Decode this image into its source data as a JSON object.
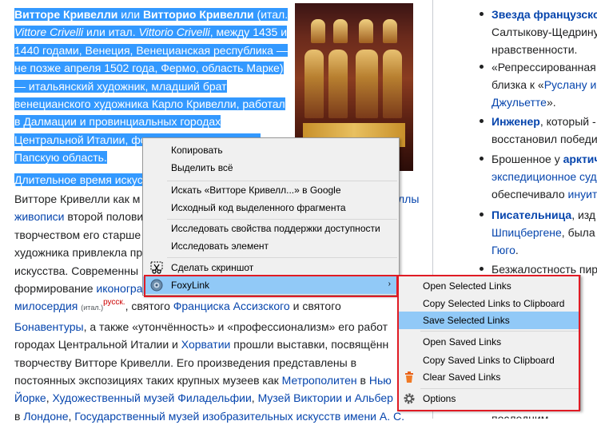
{
  "article": {
    "p1_bold1": "Витторе Кривелли",
    "p1_t1": " или ",
    "p1_bold2": "Витторио Кривелли",
    "p1_t2": " (итал. ",
    "p1_i1": "Vittore Crivelli",
    "p1_t3": " или итал. ",
    "p1_i2": "Vittorio Crivelli",
    "p1_t4": ", между 1435 и 1440 годами, Венеция, Венецианская республика — не позже апреля 1502 года, Фермо, область Марке) — итальянский художник, младший брат венецианского художника Карло Кривелли, работал в Далмации и провинциальных городах Центральной Италии, формально входивших в Папскую область.",
    "p2_text": "Длительное время искус",
    "p3_l1": "Витторе Кривелли как м",
    "p3_l1_link": "ллы",
    "p3_l2_link": "живописи",
    "p3_l2": " второй полови",
    "p3_l3": "творчеством его старше",
    "p3_l4": "художника привлекла пр",
    "p3_l5": "искусства. Современны",
    "p3_l6": "формирование ",
    "p3_l6_link": "иконогра",
    "p3_l7_link": "милосердия",
    "p3_l7_sub": "(итал.)",
    "p3_l7_sup": "русск.",
    "p3_l7_t": ", святого ",
    "p3_l7_link2": "Франциска Ассизского",
    "p3_l7_t2": " и святого",
    "p3_l8_link": "Бонавентуры",
    "p3_l8_t": ", а также «утончённость» и «профессионализм» его работ",
    "p3_l9_t": "городах Центральной Италии и ",
    "p3_l9_link": "Хорватии",
    "p3_l9_t2": " прошли выставки, посвящённ",
    "p3_l10": "творчеству Витторе Кривелли. Его произведения представлены в",
    "p3_l11_t": "постоянных экспозициях таких крупных музеев как ",
    "p3_l11_link": "Метрополитен",
    "p3_l11_t2": " в ",
    "p3_l11_link2": "Нью",
    "p3_l12_link": "Йорке",
    "p3_l12_t": ", ",
    "p3_l12_link2": "Художественный музей Филадельфии",
    "p3_l12_link3": "Музей Виктории и Альбер",
    "p3_l13_t": "в ",
    "p3_l13_link": "Лондоне",
    "p3_l13_link2": "Государственный музей изобразительных искусств имени А. С."
  },
  "sidebar": {
    "r1_link": "Звезда французско",
    "r2": "Салтыкову-Щедрину",
    "r3": "нравственности.",
    "r4": "«Репрессированная",
    "r5_t": "близка к «",
    "r5_link": "Руслану и",
    "r6_link": "Джульетте",
    "r6_t": "».",
    "r7_link": "Инженер",
    "r7_t": ", который -",
    "r8": "восстановил победител",
    "r9_t": "Брошенное у ",
    "r9_link": "арктич",
    "r10_link": "экспедиционное суд",
    "r11_t": "обеспечивало ",
    "r11_link": "инуит",
    "r12_link": "Писательница",
    "r12_t": ", изд",
    "r13_link": "Шпицбергене",
    "r13_t": ", была",
    "r14_link": "Гюго",
    "r14_t": ".",
    "r15": "Безжалостность пир",
    "r16": "последним"
  },
  "context_menu": {
    "items": [
      {
        "label": "Копировать"
      },
      {
        "label": "Выделить всё"
      },
      {
        "label": "Искать «Витторе Кривелл...» в Google"
      },
      {
        "label": "Исходный код выделенного фрагмента"
      },
      {
        "label": "Исследовать свойства поддержки доступности"
      },
      {
        "label": "Исследовать элемент"
      },
      {
        "label": "Сделать скриншот"
      },
      {
        "label": "FoxyLink"
      }
    ],
    "submenu_arrow": "›"
  },
  "foxylink_submenu": {
    "items": [
      {
        "label": "Open Selected Links"
      },
      {
        "label": "Copy Selected Links to Clipboard"
      },
      {
        "label": "Save Selected Links"
      },
      {
        "label": "Open Saved Links"
      },
      {
        "label": "Copy Saved Links to Clipboard"
      },
      {
        "label": "Clear Saved Links"
      },
      {
        "label": "Options"
      }
    ],
    "highlighted": "Save Selected Links"
  },
  "colors": {
    "selection": "#3399ff",
    "link": "#0645ad",
    "menu_highlight": "#91c9f7",
    "annotation_box": "#e01b24"
  }
}
